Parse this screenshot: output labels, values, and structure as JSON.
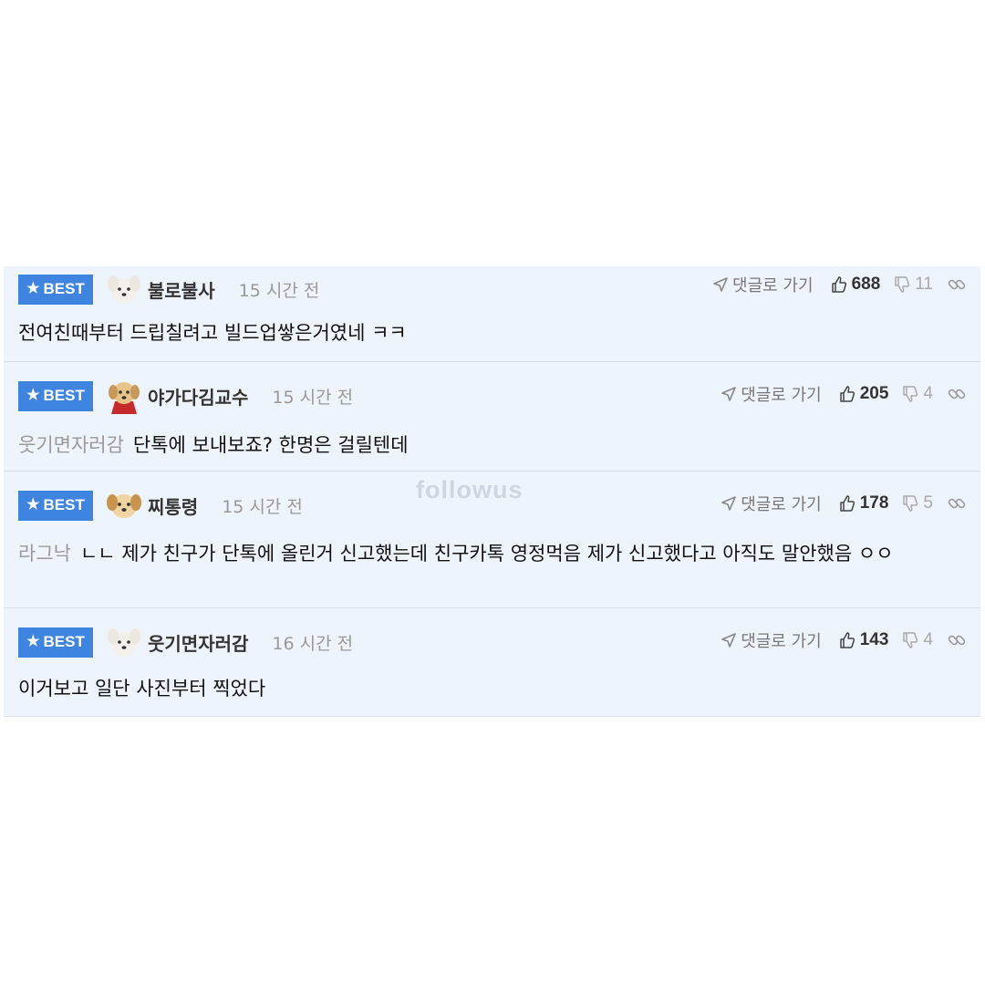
{
  "watermark": "followus",
  "labels": {
    "badge": "BEST",
    "reply": "댓글로 가기"
  },
  "comments": [
    {
      "nick": "불로불사",
      "time": "15 시간 전",
      "avatar": "white-puppy",
      "text": "전여친때부터 드립칠려고 빌드업쌓은거였네 ㅋㅋ",
      "mention": "",
      "likes": "688",
      "dislikes": "11"
    },
    {
      "nick": "야가다김교수",
      "time": "15 시간 전",
      "avatar": "puppy-red-cape",
      "text": "단톡에 보내보죠? 한명은 걸릴텐데",
      "mention": "웃기면자러감",
      "likes": "205",
      "dislikes": "4"
    },
    {
      "nick": "찌통령",
      "time": "15 시간 전",
      "avatar": "golden-puppy",
      "text": "ㄴㄴ 제가 친구가 단톡에 올린거 신고했는데 친구카톡 영정먹음 제가 신고했다고 아직도 말안했음 ㅇㅇ",
      "mention": "라그낙",
      "likes": "178",
      "dislikes": "5"
    },
    {
      "nick": "웃기면자러감",
      "time": "16 시간 전",
      "avatar": "white-puppy",
      "text": "이거보고 일단 사진부터 찍었다",
      "mention": "",
      "likes": "143",
      "dislikes": "4"
    }
  ],
  "colors": {
    "badge": "#3f85e0",
    "panel": "#eef4fb",
    "mention": "#9a9a9a"
  }
}
